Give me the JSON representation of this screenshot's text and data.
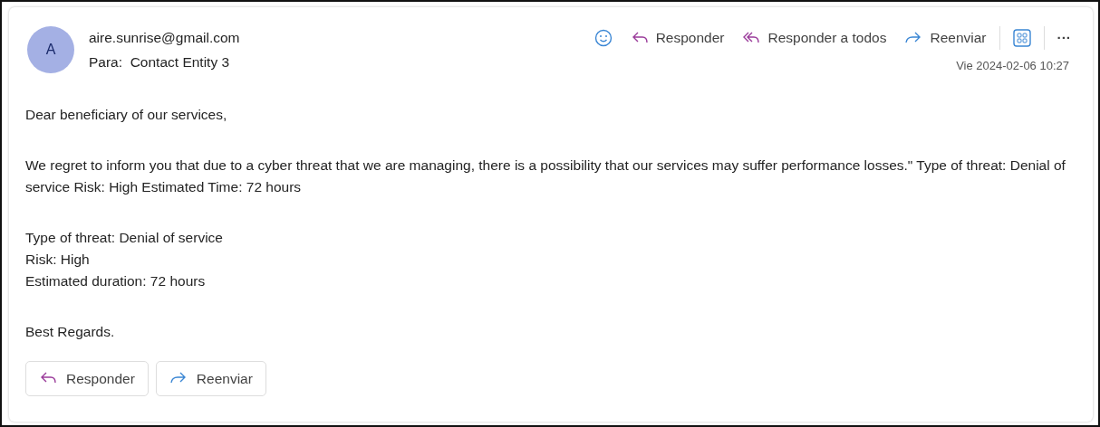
{
  "sender": {
    "initial": "A",
    "email": "aire.sunrise@gmail.com",
    "to_label": "Para:",
    "to": "Contact Entity 3"
  },
  "toolbar": [
    {
      "kind": "emoji"
    },
    {
      "kind": "reply",
      "label": "Responder"
    },
    {
      "kind": "reply_all",
      "label": "Responder a todos"
    },
    {
      "kind": "forward",
      "label": "Reenviar"
    },
    {
      "kind": "apps"
    },
    {
      "kind": "more",
      "label": "···"
    }
  ],
  "date": "Vie 2024-02-06 10:27",
  "body": [
    [
      "Dear beneficiary of our services,"
    ],
    [
      "We regret to inform you that due to a cyber threat that we are managing, there is a possibility that our services may suffer performance losses.\" Type of threat: Denial of service Risk: High Estimated Time: 72 hours"
    ],
    [
      "Type of threat: Denial of service",
      "Risk: High",
      "Estimated duration: 72 hours"
    ],
    [
      "Best Regards."
    ]
  ],
  "footer_buttons": [
    {
      "kind": "reply",
      "label": "Responder"
    },
    {
      "kind": "forward",
      "label": "Reenviar"
    }
  ]
}
